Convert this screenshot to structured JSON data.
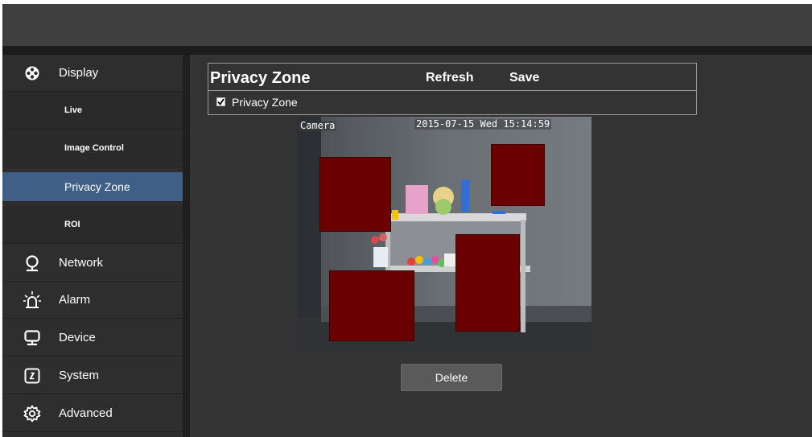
{
  "sidebar": {
    "items": [
      {
        "label": "Display",
        "icon": "display-icon"
      },
      {
        "label": "Network",
        "icon": "network-icon"
      },
      {
        "label": "Alarm",
        "icon": "alarm-icon"
      },
      {
        "label": "Device",
        "icon": "device-icon"
      },
      {
        "label": "System",
        "icon": "system-icon"
      },
      {
        "label": "Advanced",
        "icon": "advanced-icon"
      }
    ],
    "sub_items": [
      {
        "label": "Live"
      },
      {
        "label": "Image Control"
      },
      {
        "label": "Privacy Zone",
        "active": true
      },
      {
        "label": "ROI"
      }
    ]
  },
  "panel": {
    "title": "Privacy Zone",
    "refresh_label": "Refresh",
    "save_label": "Save",
    "checkbox_label": "Privacy Zone",
    "checkbox_checked": true
  },
  "camera": {
    "name_osd": "Camera",
    "time_osd": "2015-07-15 Wed 15:14:59",
    "zone_count": 4,
    "zone_color": "#6b0000"
  },
  "delete_label": "Delete",
  "colors": {
    "active_nav": "#3f5f86",
    "sidebar_bg": "#2e2e2e",
    "main_bg": "#333333",
    "topbar_bg": "#3f3f3f"
  }
}
